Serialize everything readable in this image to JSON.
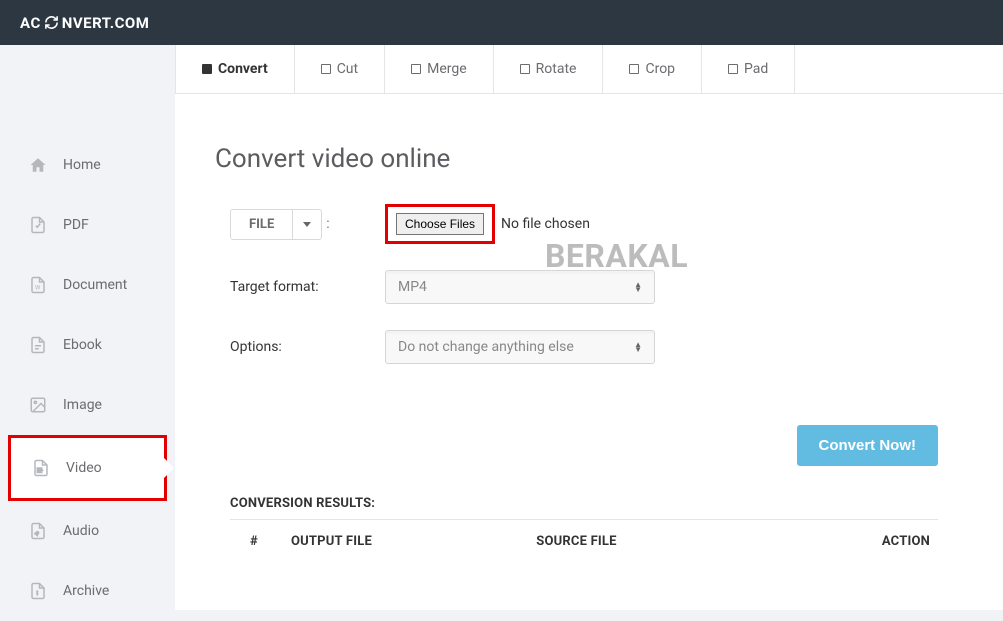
{
  "header": {
    "logo_left": "AC",
    "logo_right": "NVERT.COM"
  },
  "sidebar": {
    "items": [
      {
        "label": "Home",
        "icon": "home"
      },
      {
        "label": "PDF",
        "icon": "pdf"
      },
      {
        "label": "Document",
        "icon": "document"
      },
      {
        "label": "Ebook",
        "icon": "ebook"
      },
      {
        "label": "Image",
        "icon": "image"
      },
      {
        "label": "Video",
        "icon": "video"
      },
      {
        "label": "Audio",
        "icon": "audio"
      },
      {
        "label": "Archive",
        "icon": "archive"
      }
    ]
  },
  "tabs": [
    {
      "label": "Convert",
      "active": true
    },
    {
      "label": "Cut",
      "active": false
    },
    {
      "label": "Merge",
      "active": false
    },
    {
      "label": "Rotate",
      "active": false
    },
    {
      "label": "Crop",
      "active": false
    },
    {
      "label": "Pad",
      "active": false
    }
  ],
  "page": {
    "title": "Convert video online",
    "file_button": "FILE",
    "choose_files": "Choose Files",
    "no_file": "No file chosen",
    "target_format_label": "Target format:",
    "target_format_value": "MP4",
    "options_label": "Options:",
    "options_value": "Do not change anything else",
    "convert_button": "Convert Now!",
    "watermark": "BERAKAL"
  },
  "results": {
    "title": "CONVERSION RESULTS:",
    "columns": [
      "#",
      "OUTPUT FILE",
      "SOURCE FILE",
      "ACTION"
    ]
  }
}
